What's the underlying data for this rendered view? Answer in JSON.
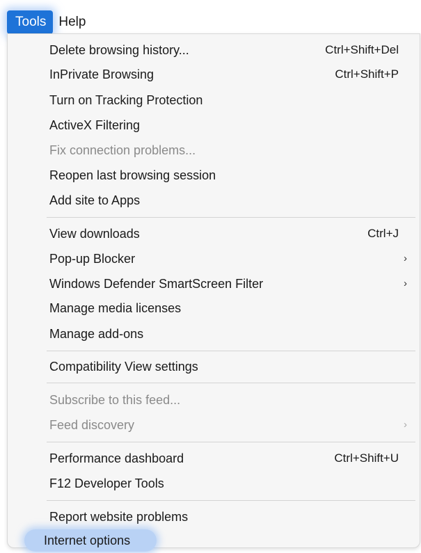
{
  "menubar": {
    "items": [
      {
        "label": "Tools"
      },
      {
        "label": "Help"
      }
    ]
  },
  "menu": {
    "items": [
      {
        "label": "Delete browsing history...",
        "shortcut": "Ctrl+Shift+Del"
      },
      {
        "label": "InPrivate Browsing",
        "shortcut": "Ctrl+Shift+P"
      },
      {
        "label": "Turn on Tracking Protection"
      },
      {
        "label": "ActiveX Filtering"
      },
      {
        "label": "Fix connection problems...",
        "disabled": true
      },
      {
        "label": "Reopen last browsing session"
      },
      {
        "label": "Add site to Apps"
      },
      {
        "label": "View downloads",
        "shortcut": "Ctrl+J"
      },
      {
        "label": "Pop-up Blocker",
        "submenu": true
      },
      {
        "label": "Windows Defender SmartScreen Filter",
        "submenu": true
      },
      {
        "label": "Manage media licenses"
      },
      {
        "label": "Manage add-ons"
      },
      {
        "label": "Compatibility View settings"
      },
      {
        "label": "Subscribe to this feed...",
        "disabled": true
      },
      {
        "label": "Feed discovery",
        "disabled": true,
        "submenu": true
      },
      {
        "label": "Performance dashboard",
        "shortcut": "Ctrl+Shift+U"
      },
      {
        "label": "F12 Developer Tools"
      },
      {
        "label": "Report website problems"
      },
      {
        "label": "Internet options",
        "highlighted": true
      }
    ],
    "submenu_arrow": "›"
  }
}
